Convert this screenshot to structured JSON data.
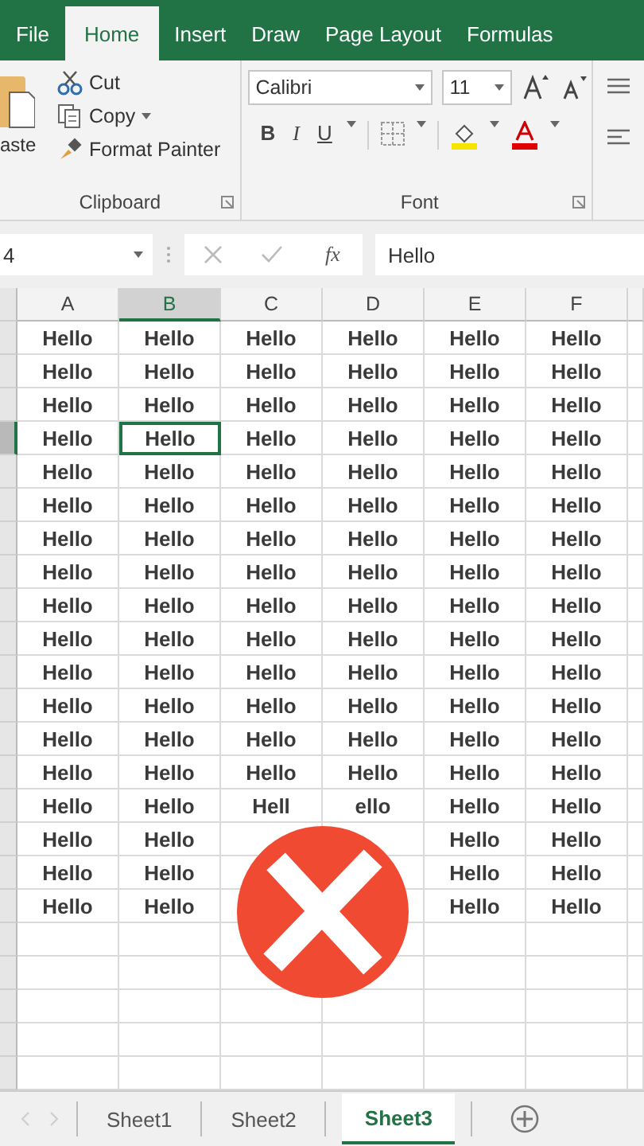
{
  "ribbon_tabs": [
    {
      "label": "File",
      "selected": false
    },
    {
      "label": "Home",
      "selected": true
    },
    {
      "label": "Insert",
      "selected": false
    },
    {
      "label": "Draw",
      "selected": false
    },
    {
      "label": "Page Layout",
      "selected": false
    },
    {
      "label": "Formulas",
      "selected": false
    }
  ],
  "clipboard": {
    "paste": "aste",
    "cut": "Cut",
    "copy": "Copy",
    "format_painter": "Format Painter",
    "group_label": "Clipboard"
  },
  "font": {
    "name": "Calibri",
    "size": "11",
    "bold": "B",
    "italic": "I",
    "underline": "U",
    "group_label": "Font"
  },
  "formula_bar": {
    "name_box": "4",
    "function_label": "fx",
    "value": "Hello"
  },
  "columns": [
    {
      "label": "A",
      "selected": false
    },
    {
      "label": "B",
      "selected": true
    },
    {
      "label": "C",
      "selected": false
    },
    {
      "label": "D",
      "selected": false
    },
    {
      "label": "E",
      "selected": false
    },
    {
      "label": "F",
      "selected": false
    }
  ],
  "rows": [
    {
      "selected": false,
      "cells": [
        "Hello",
        "Hello",
        "Hello",
        "Hello",
        "Hello",
        "Hello"
      ]
    },
    {
      "selected": false,
      "cells": [
        "Hello",
        "Hello",
        "Hello",
        "Hello",
        "Hello",
        "Hello"
      ]
    },
    {
      "selected": false,
      "cells": [
        "Hello",
        "Hello",
        "Hello",
        "Hello",
        "Hello",
        "Hello"
      ]
    },
    {
      "selected": true,
      "cells": [
        "Hello",
        "Hello",
        "Hello",
        "Hello",
        "Hello",
        "Hello"
      ]
    },
    {
      "selected": false,
      "cells": [
        "Hello",
        "Hello",
        "Hello",
        "Hello",
        "Hello",
        "Hello"
      ]
    },
    {
      "selected": false,
      "cells": [
        "Hello",
        "Hello",
        "Hello",
        "Hello",
        "Hello",
        "Hello"
      ]
    },
    {
      "selected": false,
      "cells": [
        "Hello",
        "Hello",
        "Hello",
        "Hello",
        "Hello",
        "Hello"
      ]
    },
    {
      "selected": false,
      "cells": [
        "Hello",
        "Hello",
        "Hello",
        "Hello",
        "Hello",
        "Hello"
      ]
    },
    {
      "selected": false,
      "cells": [
        "Hello",
        "Hello",
        "Hello",
        "Hello",
        "Hello",
        "Hello"
      ]
    },
    {
      "selected": false,
      "cells": [
        "Hello",
        "Hello",
        "Hello",
        "Hello",
        "Hello",
        "Hello"
      ]
    },
    {
      "selected": false,
      "cells": [
        "Hello",
        "Hello",
        "Hello",
        "Hello",
        "Hello",
        "Hello"
      ]
    },
    {
      "selected": false,
      "cells": [
        "Hello",
        "Hello",
        "Hello",
        "Hello",
        "Hello",
        "Hello"
      ]
    },
    {
      "selected": false,
      "cells": [
        "Hello",
        "Hello",
        "Hello",
        "Hello",
        "Hello",
        "Hello"
      ]
    },
    {
      "selected": false,
      "cells": [
        "Hello",
        "Hello",
        "Hello",
        "Hello",
        "Hello",
        "Hello"
      ]
    },
    {
      "selected": false,
      "cells": [
        "Hello",
        "Hello",
        "Hell",
        "ello",
        "Hello",
        "Hello"
      ]
    },
    {
      "selected": false,
      "cells": [
        "Hello",
        "Hello",
        null,
        null,
        "Hello",
        "Hello"
      ]
    },
    {
      "selected": false,
      "cells": [
        "Hello",
        "Hello",
        null,
        null,
        "Hello",
        "Hello"
      ]
    },
    {
      "selected": false,
      "cells": [
        "Hello",
        "Hello",
        null,
        null,
        "Hello",
        "Hello"
      ]
    }
  ],
  "overlay": {
    "kind": "cross-badge"
  },
  "sheet_tabs": [
    {
      "label": "Sheet1",
      "selected": false
    },
    {
      "label": "Sheet2",
      "selected": false
    },
    {
      "label": "Sheet3",
      "selected": true
    }
  ]
}
